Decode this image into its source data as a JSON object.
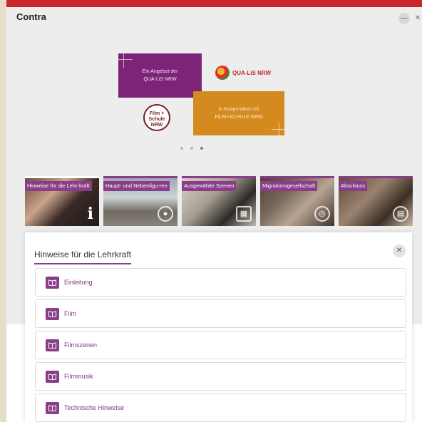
{
  "app": {
    "title": "Contra",
    "minimize_glyph": "—",
    "close_glyph": "✕"
  },
  "slider": {
    "card_purple": {
      "line1": "Ein Angebot der",
      "line2": "QUA-LiS NRW"
    },
    "card_orange": {
      "line1": "in Kooperation mit",
      "line2": "FILM+SCHULE NRW"
    },
    "qualis_logo_text": "QUA-LiS NRW",
    "film_logo_text": "Film + Schule NRW",
    "dots": 3,
    "active_dot": 3
  },
  "tiles": [
    {
      "label": "Hinweise für die Lehr-kraft",
      "active": true
    },
    {
      "label": "Haupt- und Nebenfigu-ren"
    },
    {
      "label": "Ausgewählte Szenen"
    },
    {
      "label": "Migrationsgesellschaft"
    },
    {
      "label": "Abschluss"
    }
  ],
  "panel": {
    "title": "Hinweise für die Lehrkraft",
    "close_glyph": "✕",
    "items": [
      {
        "label": "Einleitung",
        "icon": "book-icon"
      },
      {
        "label": "Film",
        "icon": "book-icon"
      },
      {
        "label": "Filmszenen",
        "icon": "book-icon"
      },
      {
        "label": "Filmmusik",
        "icon": "book-icon"
      },
      {
        "label": "Technische Hinweise",
        "icon": "book-icon"
      }
    ]
  },
  "colors": {
    "accent": "#8a3e8a",
    "top_bar": "#c9262d",
    "orange": "#d48a1f"
  }
}
